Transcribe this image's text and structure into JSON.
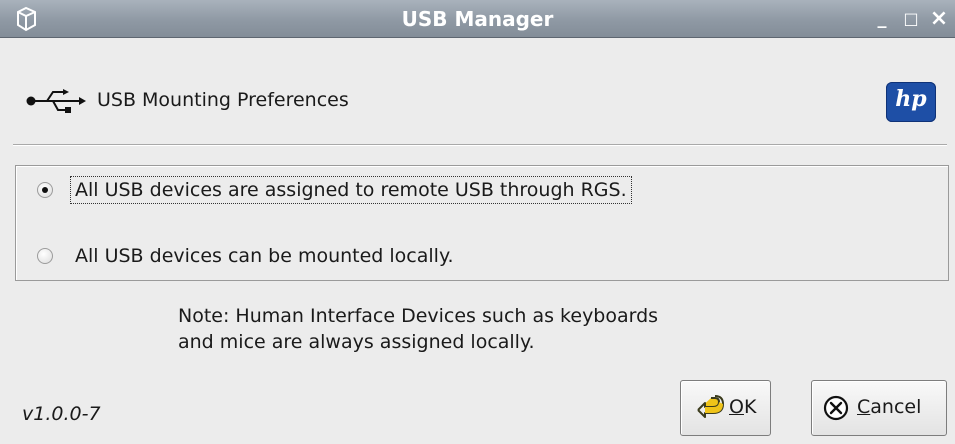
{
  "window": {
    "title": "USB Manager",
    "controls": {
      "minimize": "_",
      "maximize": "□",
      "close": "×"
    },
    "icon": "cube-icon"
  },
  "header": {
    "label": "USB Mounting Preferences",
    "usb_icon": "usb-icon",
    "logo_text": "hp"
  },
  "options": [
    {
      "label": "All USB devices are assigned to remote USB through RGS.",
      "selected": true
    },
    {
      "label": "All USB devices can be mounted locally.",
      "selected": false
    }
  ],
  "note": {
    "line1": "Note:  Human Interface Devices such as keyboards",
    "line2": "and mice are always assigned locally."
  },
  "version": "v1.0.0-7",
  "buttons": {
    "ok": {
      "mnemonic": "O",
      "rest": "K",
      "icon": "ok-arrow-icon"
    },
    "cancel": {
      "mnemonic": "C",
      "rest": "ancel",
      "icon": "cancel-x-icon"
    }
  },
  "colors": {
    "titlebar": "#8f99a4",
    "background": "#ececec",
    "hp_blue": "#1e4fa6"
  }
}
